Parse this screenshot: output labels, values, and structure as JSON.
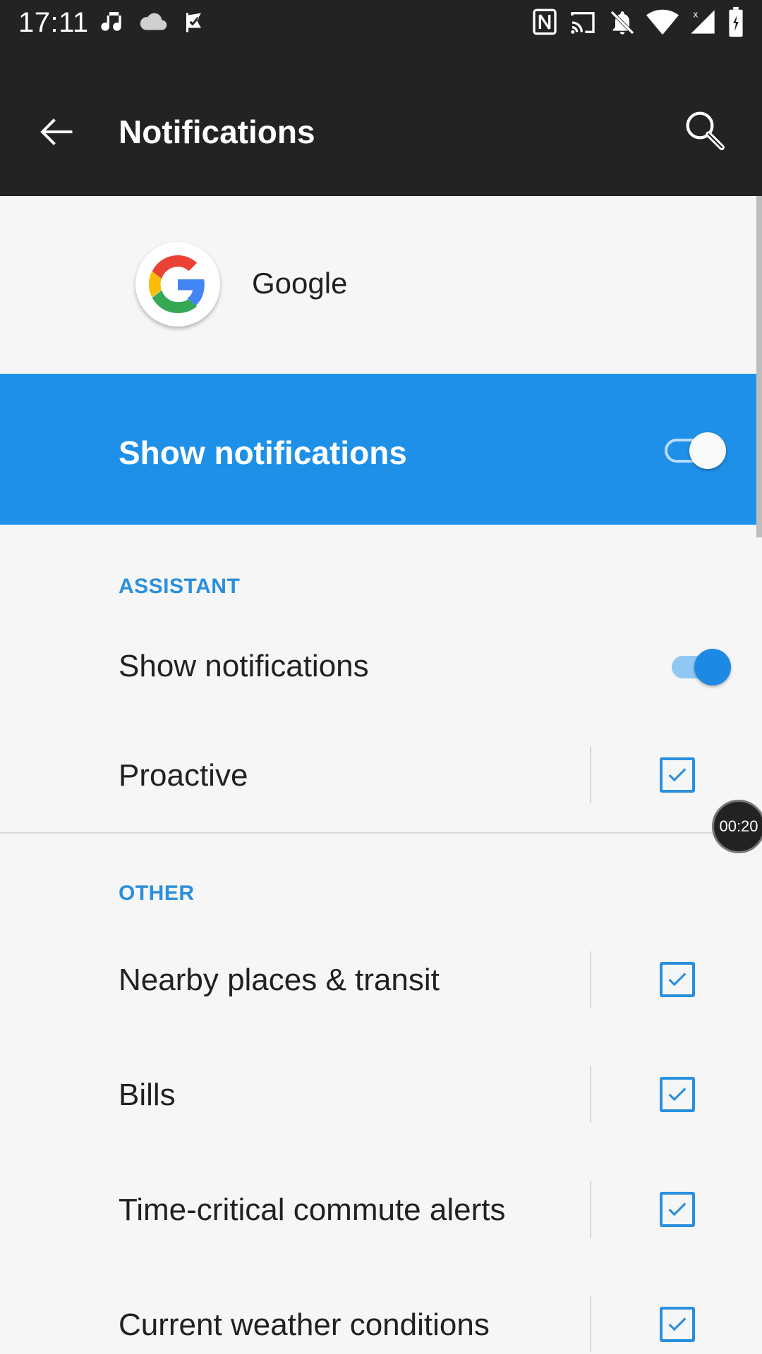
{
  "status_bar": {
    "time": "17:11",
    "left_icons": [
      "music-note-icon",
      "cloud-icon",
      "check-flag-icon"
    ],
    "right_icons": [
      "nfc-icon",
      "cast-icon",
      "notifications-off-icon",
      "wifi-icon",
      "signal-icon",
      "battery-charging-icon"
    ]
  },
  "app_bar": {
    "title": "Notifications",
    "back_icon": "arrow-back-icon",
    "search_icon": "search-icon"
  },
  "app": {
    "name": "Google",
    "icon": "google-g-logo"
  },
  "master_switch": {
    "label": "Show notifications",
    "on": true
  },
  "sections": {
    "assistant": {
      "header": "ASSISTANT",
      "show_notifications_label": "Show notifications",
      "show_notifications_on": true,
      "items": [
        {
          "label": "Proactive",
          "checked": true
        }
      ]
    },
    "other": {
      "header": "OTHER",
      "items": [
        {
          "label": "Nearby places & transit",
          "checked": true
        },
        {
          "label": "Bills",
          "checked": true
        },
        {
          "label": "Time-critical commute alerts",
          "checked": true
        },
        {
          "label": "Current weather conditions",
          "checked": true
        }
      ]
    }
  },
  "overlay": {
    "timer": "00:20"
  },
  "colors": {
    "accent": "#1e90e8",
    "toolbar": "#222323",
    "background": "#f5f6f5"
  }
}
